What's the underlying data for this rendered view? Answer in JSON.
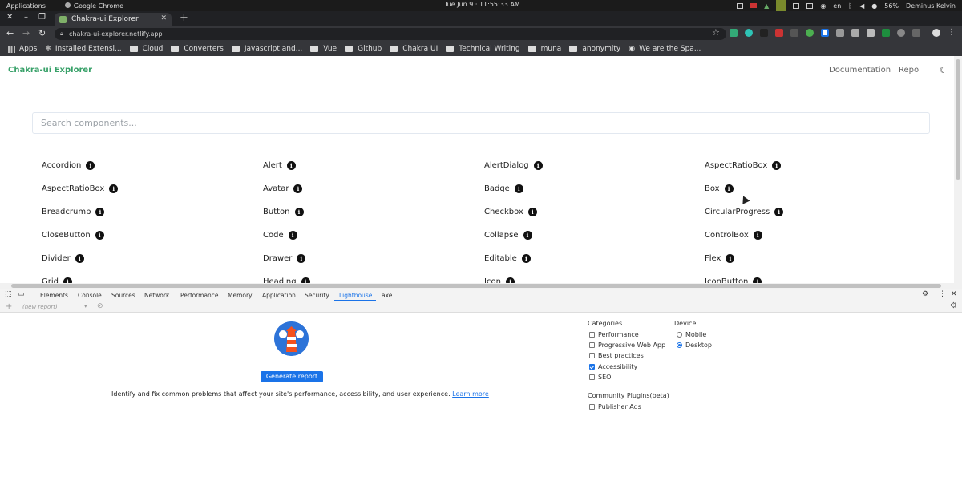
{
  "os": {
    "applications": "Applications",
    "app_name": "Google Chrome",
    "clock": "Tue Jun 9 · 11:55:33 AM",
    "lang": "en",
    "battery": "56%",
    "user": "Deminus Kelvin"
  },
  "browser": {
    "tab_title": "Chakra-ui Explorer",
    "url": "chakra-ui-explorer.netlify.app",
    "bookmarks": [
      "Apps",
      "Installed Extensi...",
      "Cloud",
      "Converters",
      "Javascript and...",
      "Vue",
      "Github",
      "Chakra UI",
      "Technical Writing",
      "muna",
      "anonymity",
      "We are the Spa..."
    ]
  },
  "page": {
    "brand": "Chakra-ui Explorer",
    "nav_documentation": "Documentation",
    "nav_repo": "Repo",
    "search_placeholder": "Search components...",
    "components": [
      [
        "Accordion",
        "Alert",
        "AlertDialog",
        "AspectRatioBox"
      ],
      [
        "AspectRatioBox",
        "Avatar",
        "Badge",
        "Box"
      ],
      [
        "Breadcrumb",
        "Button",
        "Checkbox",
        "CircularProgress"
      ],
      [
        "CloseButton",
        "Code",
        "Collapse",
        "ControlBox"
      ],
      [
        "Divider",
        "Drawer",
        "Editable",
        "Flex"
      ],
      [
        "Grid",
        "Heading",
        "Icon",
        "IconButton"
      ]
    ]
  },
  "devtools": {
    "tabs": [
      "Elements",
      "Console",
      "Sources",
      "Network",
      "Performance",
      "Memory",
      "Application",
      "Security",
      "Lighthouse",
      "axe"
    ],
    "active_tab": "Lighthouse",
    "report_select": "(new report)",
    "generate_label": "Generate report",
    "description": "Identify and fix common problems that affect your site's performance, accessibility, and user experience.",
    "learn_more": "Learn more",
    "categories_title": "Categories",
    "categories": [
      {
        "label": "Performance",
        "checked": false
      },
      {
        "label": "Progressive Web App",
        "checked": false
      },
      {
        "label": "Best practices",
        "checked": false
      },
      {
        "label": "Accessibility",
        "checked": true
      },
      {
        "label": "SEO",
        "checked": false
      }
    ],
    "device_title": "Device",
    "devices": [
      {
        "label": "Mobile",
        "checked": false
      },
      {
        "label": "Desktop",
        "checked": true
      }
    ],
    "plugins_title": "Community Plugins(beta)",
    "plugins": [
      {
        "label": "Publisher Ads",
        "checked": false
      }
    ]
  },
  "colors": {
    "brand": "#38a169",
    "accent": "#1a73e8"
  }
}
